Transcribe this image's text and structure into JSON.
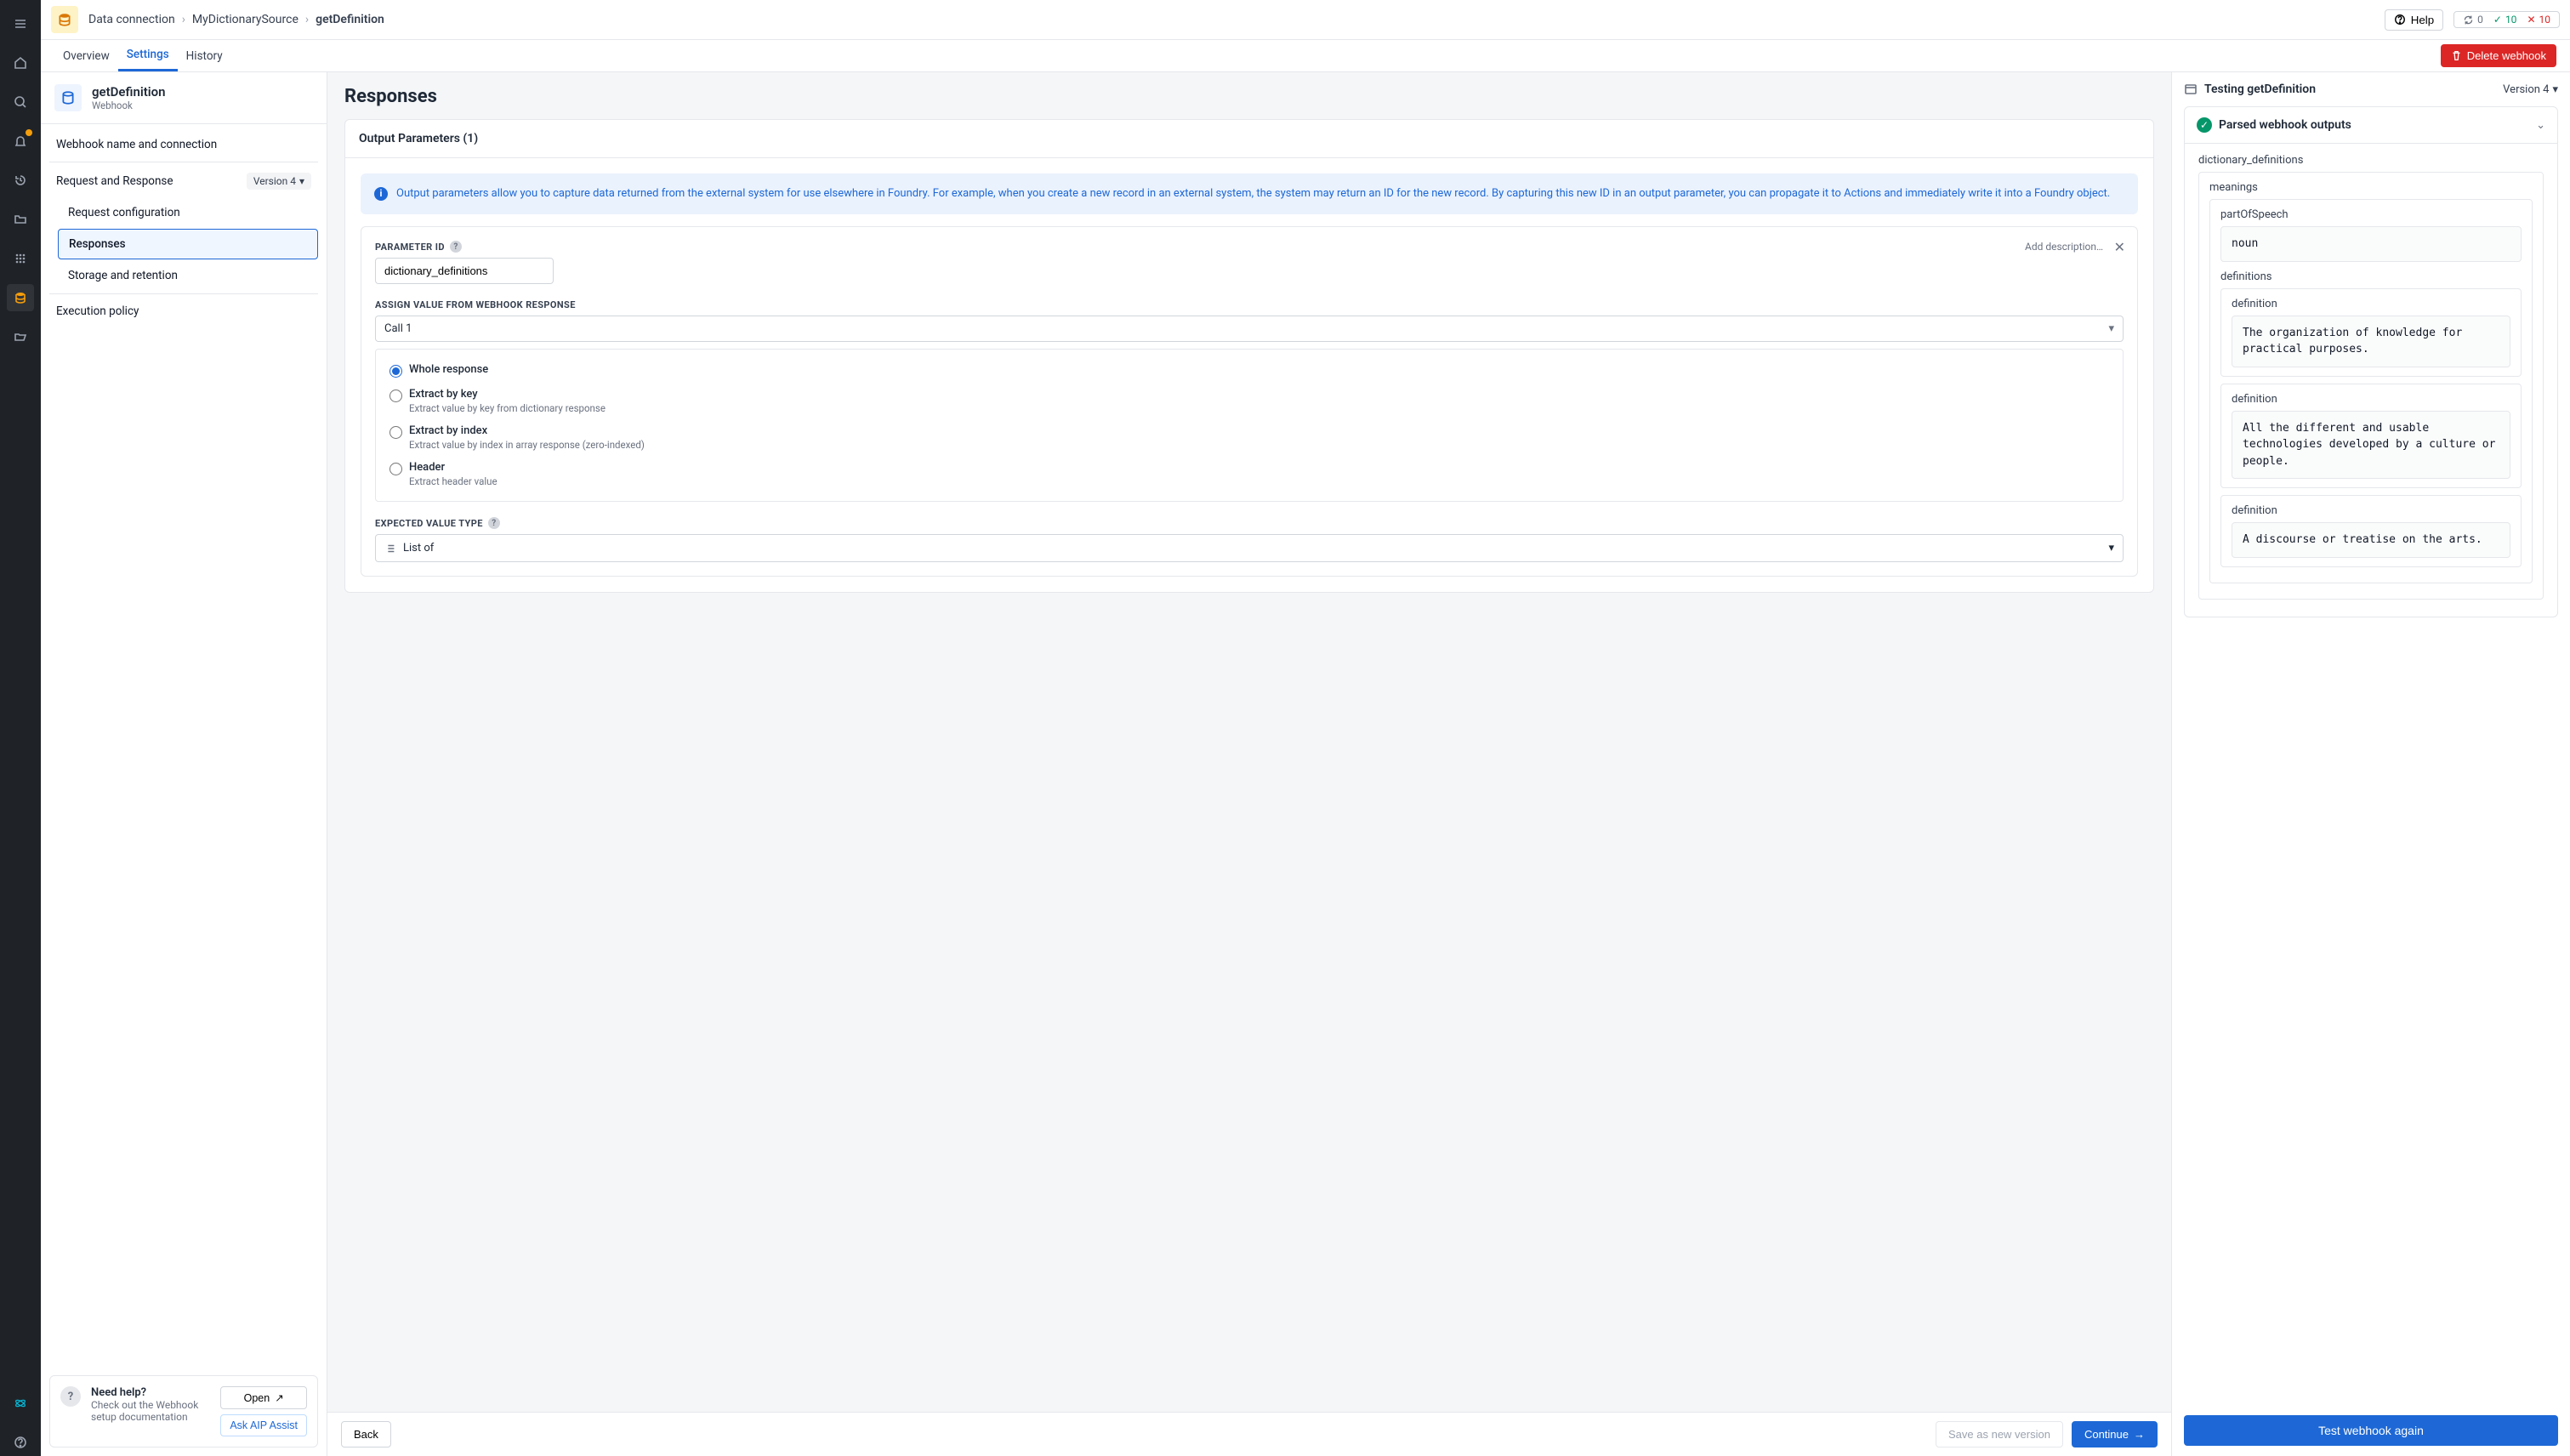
{
  "breadcrumbs": {
    "root": "Data connection",
    "mid": "MyDictionarySource",
    "leaf": "getDefinition"
  },
  "topbar": {
    "help": "Help",
    "sync_count": "0",
    "pass_count": "10",
    "fail_count": "10"
  },
  "tabs": {
    "overview": "Overview",
    "settings": "Settings",
    "history": "History",
    "delete": "Delete webhook"
  },
  "left": {
    "title": "getDefinition",
    "subtitle": "Webhook",
    "nav": {
      "conn": "Webhook name and connection",
      "rr": "Request and Response",
      "version": "Version 4",
      "req": "Request configuration",
      "resp": "Responses",
      "storage": "Storage and retention",
      "exec": "Execution policy"
    },
    "helpcard": {
      "title": "Need help?",
      "desc": "Check out the Webhook setup documentation",
      "open": "Open",
      "aip": "Ask AIP Assist"
    }
  },
  "center": {
    "heading": "Responses",
    "card_title": "Output Parameters (1)",
    "info": "Output parameters allow you to capture data returned from the external system for use elsewhere in Foundry. For example, when you create a new record in an external system, the system may return an ID for the new record. By capturing this new ID in an output parameter, you can propagate it to Actions and immediately write it into a Foundry object.",
    "param_label": "PARAMETER ID",
    "param_value": "dictionary_definitions",
    "add_desc": "Add description…",
    "assign_label": "ASSIGN VALUE FROM WEBHOOK RESPONSE",
    "call_value": "Call 1",
    "radios": {
      "whole": "Whole response",
      "key": "Extract by key",
      "key_desc": "Extract value by key from dictionary response",
      "index": "Extract by index",
      "index_desc": "Extract value by index in array response (zero-indexed)",
      "header": "Header",
      "header_desc": "Extract header value"
    },
    "type_label": "EXPECTED VALUE TYPE",
    "type_value": "List of",
    "footer": {
      "back": "Back",
      "save": "Save as new version",
      "continue": "Continue"
    }
  },
  "right": {
    "heading": "Testing getDefinition",
    "version": "Version 4",
    "out_title": "Parsed webhook outputs",
    "keys": {
      "root": "dictionary_definitions",
      "meanings": "meanings",
      "pos": "partOfSpeech",
      "pos_val": "noun",
      "defs": "definitions",
      "def": "definition"
    },
    "definitions": [
      "The organization of knowledge for practical purposes.",
      "All the different and usable technologies developed by a culture or people.",
      "A discourse or treatise on the arts."
    ],
    "test_again": "Test webhook again"
  }
}
